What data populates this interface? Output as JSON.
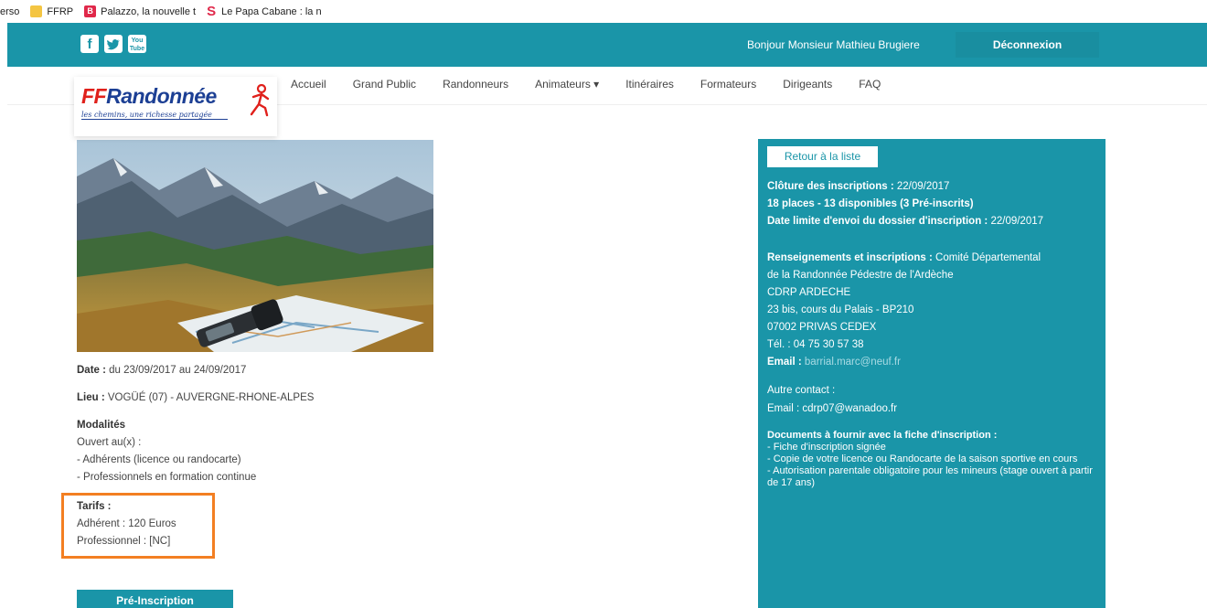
{
  "bookmarks": [
    {
      "label": "erso",
      "icon": "none"
    },
    {
      "label": "FFRP",
      "icon": "folder-icon"
    },
    {
      "label": "Palazzo, la nouvelle t",
      "icon": "palazzo-icon"
    },
    {
      "label": "Le Papa Cabane : la n",
      "icon": "s-icon"
    }
  ],
  "topbar": {
    "greeting": "Bonjour Monsieur Mathieu Brugiere",
    "logout": "Déconnexion",
    "social": [
      "facebook-icon",
      "twitter-icon",
      "youtube-icon"
    ],
    "youtube_text": "You Tube"
  },
  "logo": {
    "text_ff": "FF",
    "text_main": "Randonnée",
    "tagline": "les chemins, une richesse partagée"
  },
  "nav": [
    "Accueil",
    "Grand Public",
    "Randonneurs",
    "Animateurs ▾",
    "Itinéraires",
    "Formateurs",
    "Dirigeants",
    "FAQ"
  ],
  "event": {
    "date_label": "Date :",
    "date_value": " du 23/09/2017 au 24/09/2017",
    "lieu_label": "Lieu :",
    "lieu_value": " VOGÜÉ (07) - AUVERGNE-RHONE-ALPES",
    "modalites_label": "Modalités",
    "ouvert": "Ouvert au(x) :",
    "public1": "- Adhérents (licence ou randocarte)",
    "public2": "- Professionnels en formation continue",
    "tarifs_label": "Tarifs :",
    "tarif_adherent": "Adhérent : 120 Euros",
    "tarif_pro": "Professionnel : [NC]",
    "preinscription": "Pré-Inscription"
  },
  "panel": {
    "retour": "Retour à la liste",
    "cloture_label": "Clôture des inscriptions :",
    "cloture_value": " 22/09/2017",
    "places": "18 places - 13 disponibles (3 Pré-inscrits)",
    "date_limite": "Date limite d'envoi du dossier d'inscription :",
    "date_limite_value": " 22/09/2017",
    "renseignements_label": "Renseignements et inscriptions :",
    "renseignements_value": " Comité Départemental",
    "org_line2": "de la Randonnée Pédestre de l'Ardèche",
    "org_name": "CDRP ARDECHE",
    "address1": "23 bis, cours du Palais - BP210",
    "address2": "07002 PRIVAS CEDEX",
    "tel": "Tél. : 04 75 30 57 38",
    "email_label": "Email :",
    "email_value": " barrial.marc@neuf.fr",
    "autre_contact": "Autre contact :",
    "autre_email": "Email : cdrp07@wanadoo.fr",
    "docs_title": "Documents à fournir avec la fiche d'inscription :",
    "doc1": "- Fiche d'inscription signée",
    "doc2": "- Copie de votre licence ou Randocarte de la saison sportive en cours",
    "doc3": "- Autorisation parentale obligatoire pour les mineurs (stage ouvert à partir de 17 ans)"
  },
  "colors": {
    "teal": "#1a95a8",
    "highlight": "#f37f22",
    "brand_blue": "#1c3f94",
    "brand_red": "#e0201b"
  }
}
